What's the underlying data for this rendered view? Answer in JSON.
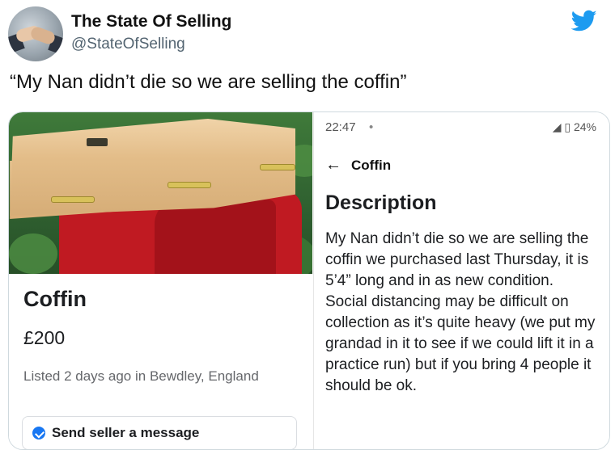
{
  "tweet": {
    "display_name": "The State Of Selling",
    "handle": "@StateOfSelling",
    "text": "“My Nan didn’t die so we are selling the coffin”",
    "brand_color": "#1d9bf0"
  },
  "listing": {
    "title": "Coffin",
    "price": "£200",
    "meta": "Listed 2 days ago in Bewdley, England",
    "send_label": "Send seller a message"
  },
  "phone": {
    "time": "22:47",
    "status_right": "24%",
    "back_title": "Coffin",
    "heading": "Description",
    "body": "My Nan didn’t die so we are selling the coffin we purchased last Thursday, it is 5’4” long and in as new condition.\nSocial distancing may be difficult on collection as it’s quite heavy (we put my grandad in it to see if we could lift it in a practice run) but if you bring 4 people it should be ok."
  },
  "icons": {
    "twitter": "twitter-bird-icon",
    "back": "back-arrow-icon",
    "send": "messenger-icon"
  }
}
